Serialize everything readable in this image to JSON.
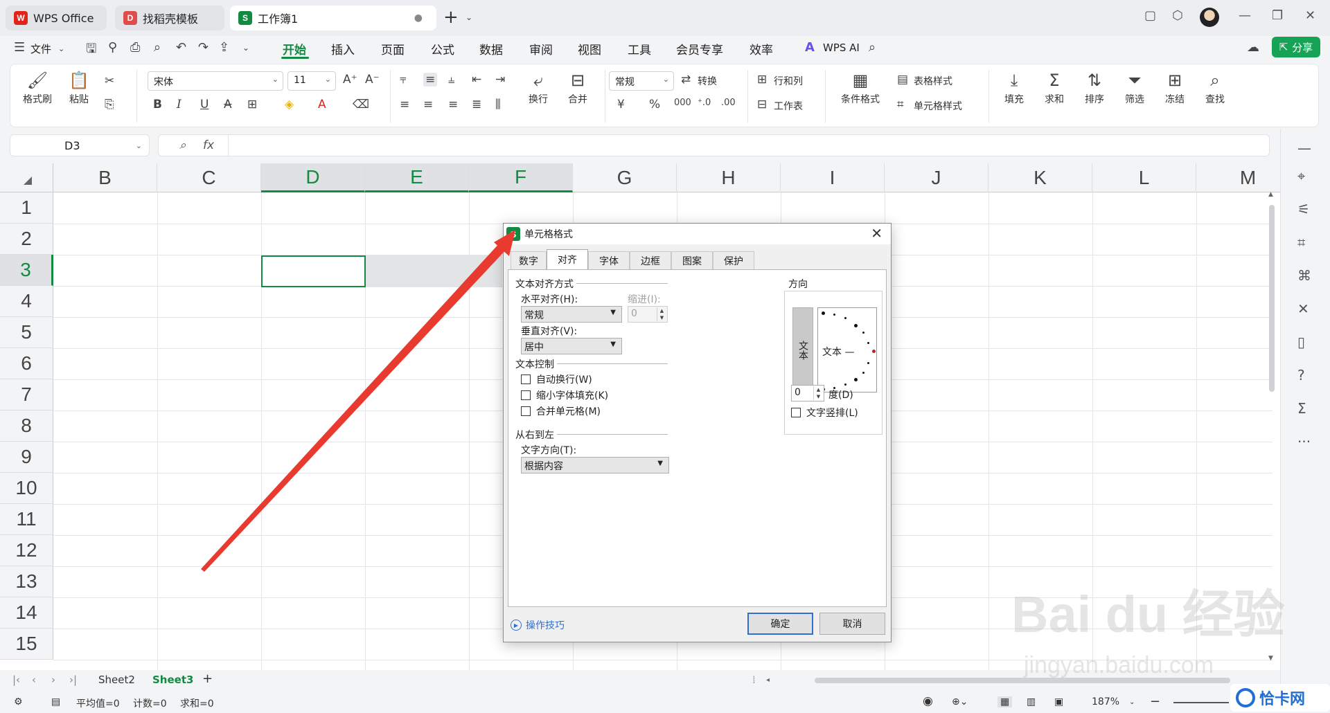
{
  "titlebar": {
    "tabs": [
      {
        "label": "WPS Office",
        "logo": "W"
      },
      {
        "label": "找稻壳模板",
        "logo": "D"
      },
      {
        "label": "工作簿1",
        "logo": "S",
        "modified_dot": "●"
      }
    ],
    "new_tab": "+",
    "new_tab_dropdown": "⌄"
  },
  "menubar": {
    "file": "文件",
    "items": [
      "开始",
      "插入",
      "页面",
      "公式",
      "数据",
      "审阅",
      "视图",
      "工具",
      "会员专享",
      "效率"
    ],
    "active": "开始",
    "ai": "WPS AI",
    "share": "分享"
  },
  "ribbon": {
    "format_painter": "格式刷",
    "paste": "粘贴",
    "font_name": "宋体",
    "font_size": "11",
    "wrap": "换行",
    "merge": "合并",
    "number_format": "常规",
    "convert": "转换",
    "rows_cols": "行和列",
    "worksheet": "工作表",
    "cond_format": "条件格式",
    "table_style": "表格样式",
    "cell_style": "单元格样式",
    "fill": "填充",
    "sum": "求和",
    "sort": "排序",
    "filter": "筛选",
    "freeze": "冻结",
    "find": "查找",
    "currency": "¥",
    "percent": "%"
  },
  "formula_bar": {
    "cell_ref": "D3",
    "fx": "fx",
    "content": ""
  },
  "grid": {
    "columns": [
      "B",
      "C",
      "D",
      "E",
      "F",
      "G",
      "H",
      "I",
      "J",
      "K",
      "L",
      "M"
    ],
    "selected_columns": [
      "D",
      "E",
      "F"
    ],
    "rows": [
      "1",
      "2",
      "3",
      "4",
      "5",
      "6",
      "7",
      "8",
      "9",
      "10",
      "11",
      "12",
      "13",
      "14",
      "15"
    ],
    "selected_row": "3"
  },
  "sheets": {
    "tabs": [
      "Sheet2",
      "Sheet3"
    ],
    "active": "Sheet3",
    "add": "+"
  },
  "status": {
    "average": "平均值=0",
    "count": "计数=0",
    "sum": "求和=0",
    "zoom": "187%"
  },
  "dialog": {
    "title": "单元格格式",
    "tabs": [
      "数字",
      "对齐",
      "字体",
      "边框",
      "图案",
      "保护"
    ],
    "active_tab": "对齐",
    "text_align_group": "文本对齐方式",
    "horizontal_label": "水平对齐(H):",
    "horizontal_value": "常规",
    "indent_label": "缩进(I):",
    "indent_value": "0",
    "vertical_label": "垂直对齐(V):",
    "vertical_value": "居中",
    "text_control_group": "文本控制",
    "wrap_text": "自动换行(W)",
    "shrink_to_fit": "缩小字体填充(K)",
    "merge_cells": "合并单元格(M)",
    "rtl_group": "从右到左",
    "text_direction_label": "文字方向(T):",
    "text_direction_value": "根据内容",
    "orientation_group": "方向",
    "vertical_text": "文本",
    "dial_text": "文本 —",
    "degree_value": "0",
    "degree_label": "度(D)",
    "stacked_text": "文字竖排(L)",
    "tips": "操作技巧",
    "ok": "确定",
    "cancel": "取消"
  },
  "watermark": {
    "main": "Bai du 经验",
    "url": "jingyan.baidu.com",
    "badge": "恰卡网"
  },
  "colors": {
    "accent_green": "#138a42",
    "arrow_red": "#e83a2e",
    "link_blue": "#2f6fd0"
  }
}
